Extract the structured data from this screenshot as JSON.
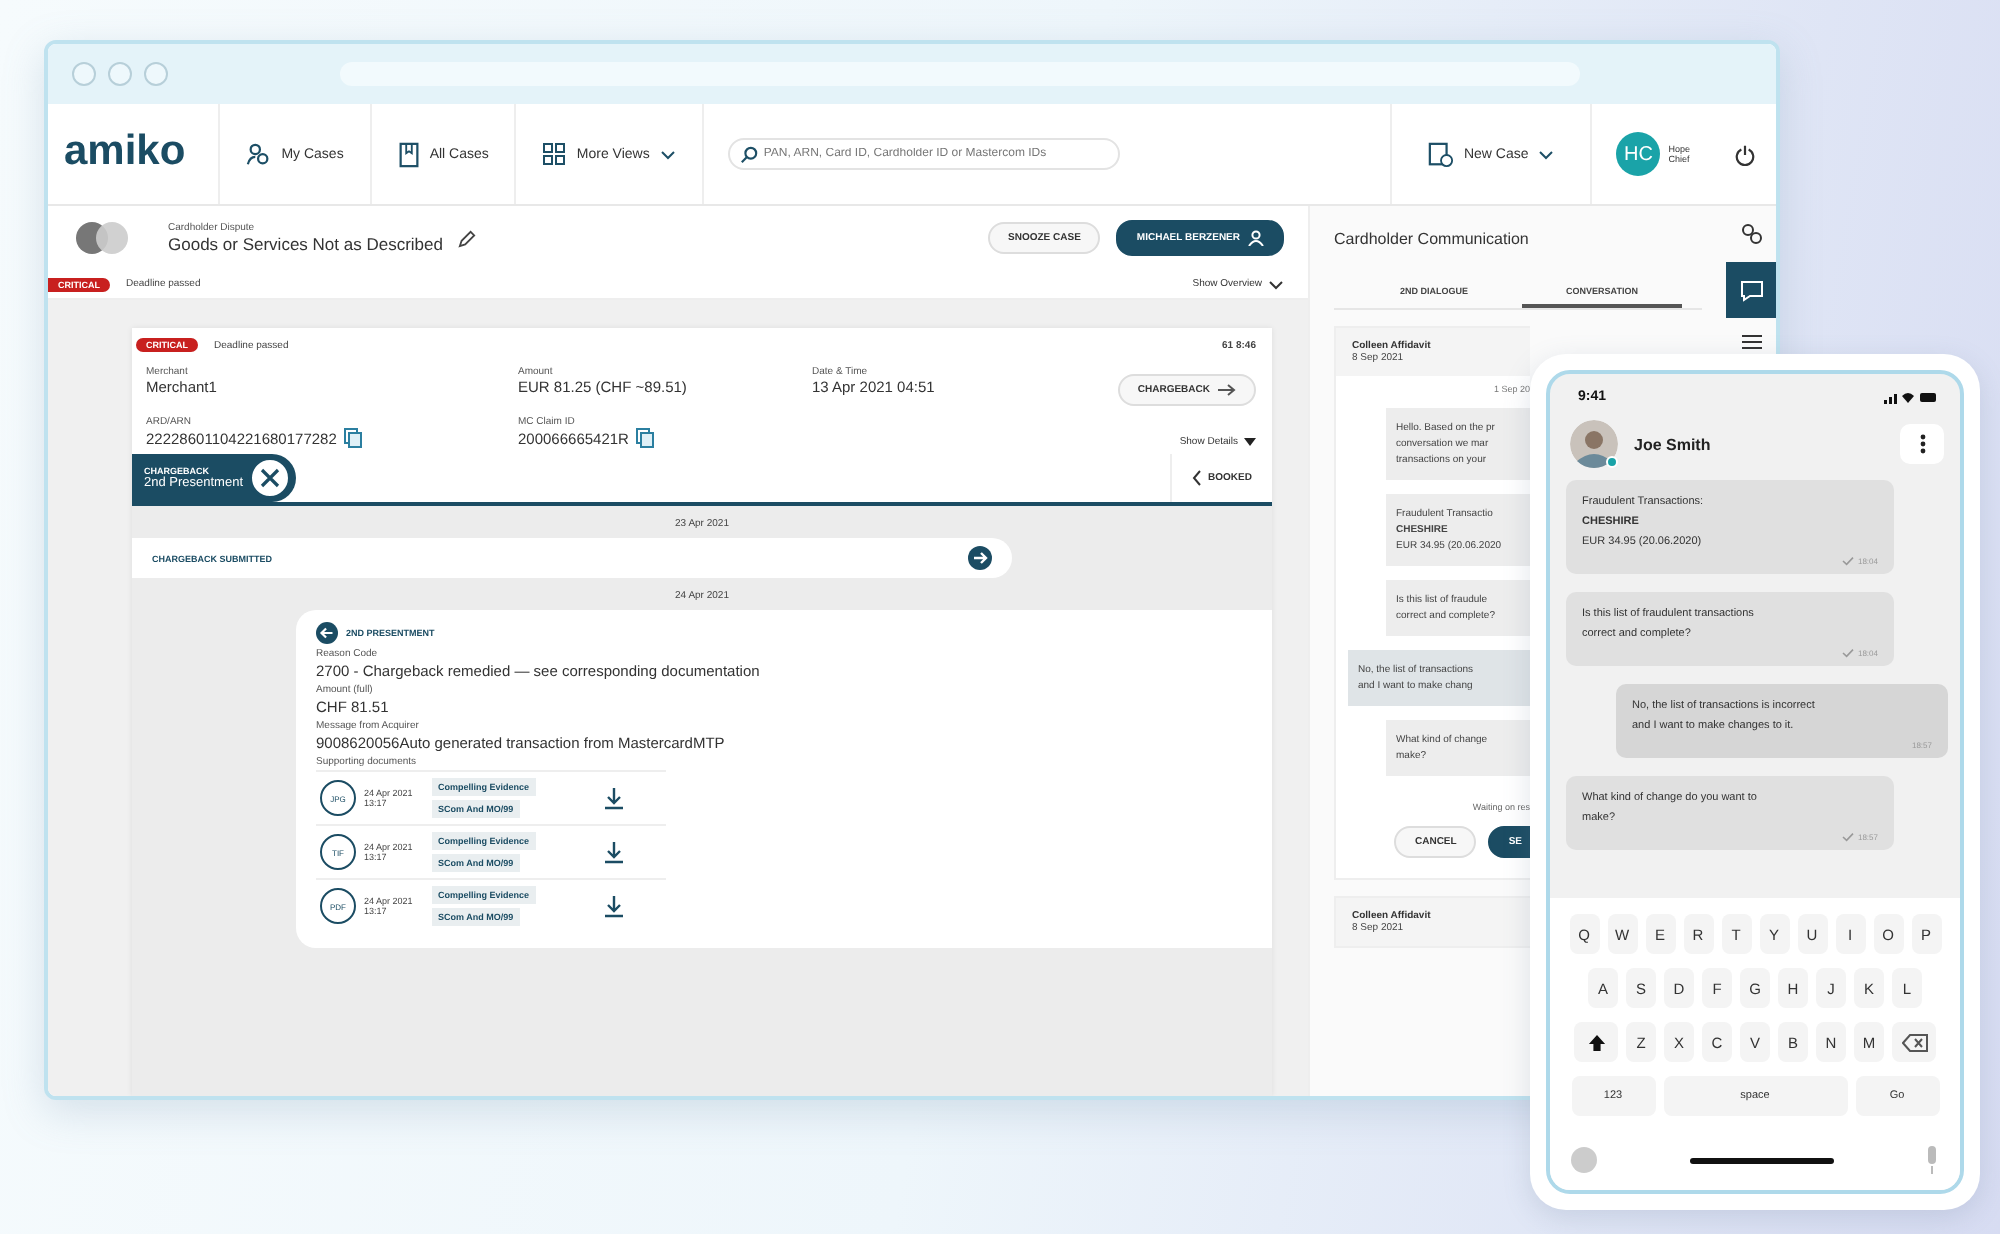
{
  "browser": {
    "logo": "amiko",
    "nav": [
      {
        "label": "My Cases"
      },
      {
        "label": "All Cases"
      },
      {
        "label": "More Views",
        "dropdown": true
      }
    ],
    "search": {
      "placeholder": "PAN, ARN, Card ID, Cardholder ID or Mastercom IDs"
    },
    "new_case": "New Case",
    "user": {
      "initials": "HC",
      "name_line_1": "Hope",
      "name_line_2": "Chief"
    }
  },
  "case_header": {
    "category": "Cardholder Dispute",
    "title": "Goods or Services Not as Described",
    "buttons": [
      {
        "label": "SNOOZE CASE",
        "primary": false
      },
      {
        "label": "MICHAEL BERZENER",
        "primary": true
      }
    ],
    "badge": "CRITICAL",
    "deadline": "Deadline passed",
    "show_overview": "Show Overview"
  },
  "case_card": {
    "badge": "CRITICAL",
    "deadline": "Deadline passed",
    "time": "61 8:46",
    "fields": [
      {
        "label": "Merchant",
        "value": "Merchant1",
        "copy": false
      },
      {
        "label": "Amount",
        "value": "EUR 81.25 (CHF ~89.51)",
        "copy": false
      },
      {
        "label": "Date & Time",
        "value": "13 Apr 2021 04:51",
        "copy": false
      },
      {
        "label": "ARD/ARN",
        "value": "22228601104221680177282",
        "copy": true
      },
      {
        "label": "MC Claim ID",
        "value": "200066665421R",
        "copy": true
      }
    ],
    "chargeback_button": "CHARGEBACK",
    "show_details": "Show Details",
    "stage": {
      "label": "CHARGEBACK",
      "value": "2nd Presentment"
    },
    "booked": "BOOKED"
  },
  "timeline": {
    "date_1": "23 Apr 2021",
    "event": "CHARGEBACK SUBMITTED",
    "date_2": "24 Apr 2021",
    "presentment": {
      "title": "2ND PRESENTMENT",
      "fields": [
        {
          "label": "Reason Code",
          "value": "2700 - Chargeback remedied — see corresponding documentation"
        },
        {
          "label": "Amount (full)",
          "value": "CHF 81.51"
        },
        {
          "label": "Message from Acquirer",
          "value": "9008620056Auto generated transaction from MastercardMTP"
        }
      ],
      "documents_label": "Supporting documents",
      "documents": [
        {
          "type": "JPG",
          "date": "24 Apr 2021",
          "time": "13:17",
          "tags": [
            "Compelling Evidence",
            "SCom And MO/99"
          ]
        },
        {
          "type": "TIF",
          "date": "24 Apr 2021",
          "time": "13:17",
          "tags": [
            "Compelling Evidence",
            "SCom And MO/99"
          ]
        },
        {
          "type": "PDF",
          "date": "24 Apr 2021",
          "time": "13:17",
          "tags": [
            "Compelling Evidence",
            "SCom And MO/99"
          ]
        }
      ]
    }
  },
  "communication": {
    "title": "Cardholder Communication",
    "tabs": [
      {
        "label": "2ND DIALOGUE",
        "selected": false
      },
      {
        "label": "CONVERSATION",
        "selected": true
      }
    ],
    "threads": [
      {
        "name": "Colleen Affidavit",
        "date": "8 Sep 2021",
        "expanded": true,
        "day": "1 Sep 20",
        "messages": [
          {
            "lines": [
              "Hello. Based on the pr",
              "conversation we mar",
              "transactions on your"
            ],
            "outgoing": true
          },
          {
            "lines": [
              "Fraudulent Transactio",
              "**CHESHIRE**",
              "EUR 34.95 (20.06.2020"
            ],
            "outgoing": true
          },
          {
            "lines": [
              "Is this list of fraudule",
              "correct and complete?"
            ],
            "outgoing": true
          },
          {
            "lines": [
              "No, the list of transactions",
              "and I want to make chang"
            ],
            "outgoing": false
          },
          {
            "lines": [
              "What kind of change",
              "make?"
            ],
            "outgoing": true
          }
        ],
        "waiting": "Waiting on res",
        "buttons": [
          {
            "label": "CANCEL",
            "primary": false
          },
          {
            "label": "SE",
            "primary": true
          }
        ]
      },
      {
        "name": "Colleen Affidavit",
        "date": "8 Sep 2021",
        "expanded": false
      }
    ]
  },
  "rail": [
    {
      "selected": false
    },
    {
      "selected": true
    },
    {
      "selected": false
    }
  ],
  "phone": {
    "time": "9:41",
    "contact": "Joe Smith",
    "online": true,
    "messages": [
      {
        "lines": [
          "Fraudulent Transactions:",
          "**CHESHIRE**",
          "EUR 34.95 (20.06.2020)"
        ],
        "time": "18:04",
        "outgoing": false,
        "read": true
      },
      {
        "lines": [
          "Is this list of fraudulent transactions",
          "correct and complete?"
        ],
        "time": "18:04",
        "outgoing": false,
        "read": true
      },
      {
        "lines": [
          "No, the list of transactions is incorrect",
          "and I want to make changes to it."
        ],
        "time": "18:57",
        "outgoing": true,
        "read": false
      },
      {
        "lines": [
          "What kind of change do you want to",
          "make?"
        ],
        "time": "18:57",
        "outgoing": false,
        "read": true
      }
    ],
    "keyboard": [
      [
        "Q",
        "W",
        "E",
        "R",
        "T",
        "Y",
        "U",
        "I",
        "O",
        "P"
      ],
      [
        "A",
        "S",
        "D",
        "F",
        "G",
        "H",
        "J",
        "K",
        "L"
      ],
      [
        "Z",
        "X",
        "C",
        "V",
        "B",
        "N",
        "M"
      ]
    ],
    "bottom_keys": [
      "123",
      "space",
      "Go"
    ]
  }
}
